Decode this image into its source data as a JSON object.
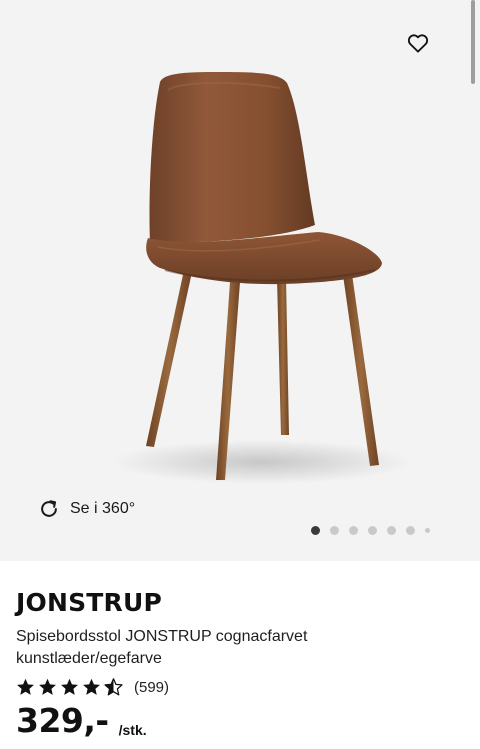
{
  "gallery": {
    "image_alt": "JONSTRUP chair",
    "view360_label": "Se i 360°",
    "dot_count": 7,
    "active_dot": 1
  },
  "product": {
    "name": "JONSTRUP",
    "description": "Spisebordsstol JONSTRUP cognacfarvet kunstlæder/egefarve",
    "rating": 4.5,
    "rating_count": "(599)",
    "price": "329,-",
    "unit": "/stk."
  },
  "icons": {
    "favorite": "heart-outline-icon",
    "rotate": "rotate-360-icon",
    "star": "star-icon"
  },
  "colors": {
    "seat": "#7a4a2f",
    "legs": "#8a5a34",
    "background": "#f3f3f3"
  }
}
